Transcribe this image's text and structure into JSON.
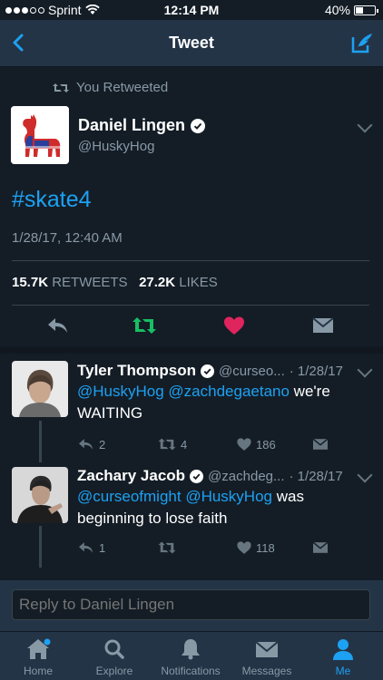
{
  "status_bar": {
    "carrier": "Sprint",
    "time": "12:14 PM",
    "battery": "40%",
    "battery_level": 0.4
  },
  "nav": {
    "title": "Tweet"
  },
  "tweet": {
    "retweet_context": "You Retweeted",
    "author_name": "Daniel Lingen",
    "author_handle": "@HuskyHog",
    "text": "#skate4",
    "timestamp": "1/28/17, 12:40 AM",
    "retweets_count": "15.7K",
    "retweets_label": "RETWEETS",
    "likes_count": "27.2K",
    "likes_label": "LIKES"
  },
  "replies": [
    {
      "name": "Tyler Thompson",
      "handle": "@curseo...",
      "date": "· 1/28/17",
      "mention1": "@HuskyHog",
      "mention2": "@zachdegaetano",
      "text_rest": " we're",
      "text_line2": "WAITING",
      "reply_count": "2",
      "retweet_count": "4",
      "like_count": "186"
    },
    {
      "name": "Zachary Jacob",
      "handle": "@zachdeg...",
      "date": "· 1/28/17",
      "mention1": "@curseofmight",
      "mention2": "@HuskyHog",
      "text_rest": " was",
      "text_line2": "beginning to lose faith",
      "reply_count": "1",
      "retweet_count": "",
      "like_count": "118"
    }
  ],
  "reply_bar": {
    "placeholder": "Reply to Daniel Lingen"
  },
  "tabs": [
    {
      "label": "Home",
      "icon": "home-icon"
    },
    {
      "label": "Explore",
      "icon": "search-icon"
    },
    {
      "label": "Notifications",
      "icon": "bell-icon"
    },
    {
      "label": "Messages",
      "icon": "envelope-icon"
    },
    {
      "label": "Me",
      "icon": "person-icon"
    }
  ],
  "colors": {
    "background": "#141d26",
    "bar": "#243447",
    "accent": "#1da1f2",
    "retweet": "#17bf63",
    "like": "#e0245e",
    "muted": "#8899a6"
  }
}
